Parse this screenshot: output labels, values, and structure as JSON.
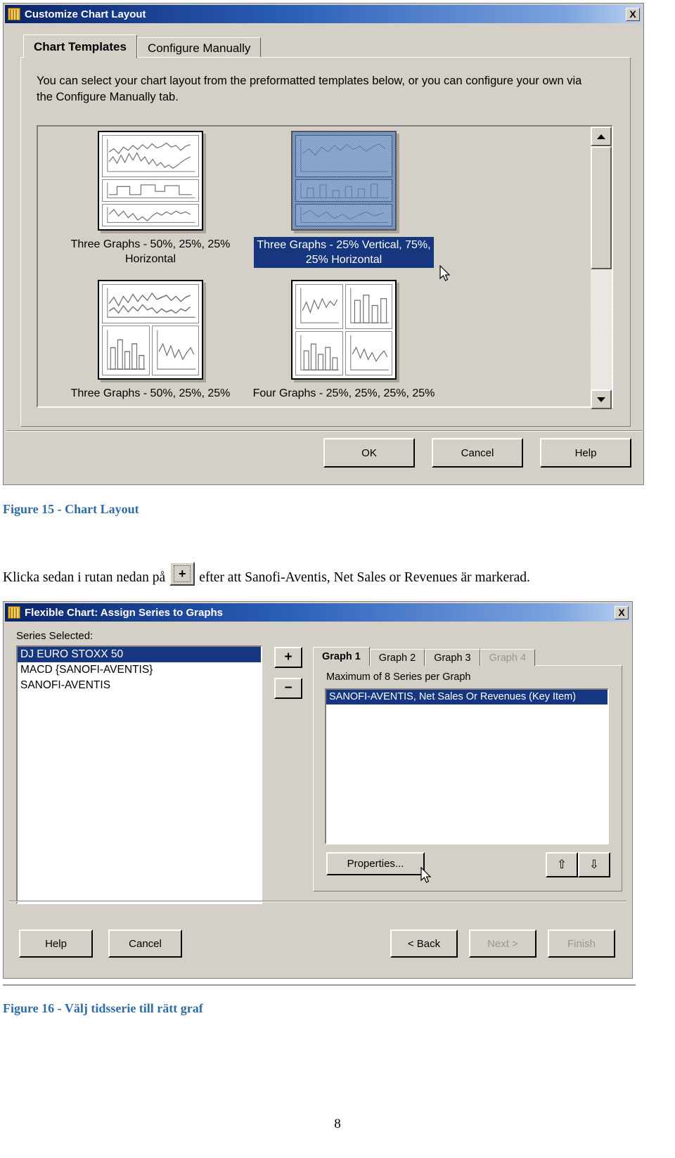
{
  "dialog1": {
    "title": "Customize Chart Layout",
    "close_label": "X",
    "tabs": [
      {
        "label": "Chart Templates",
        "active": true
      },
      {
        "label": "Configure Manually",
        "active": false
      }
    ],
    "intro_text": "You can select your chart layout from the preformatted templates below, or you can configure your own via the Configure Manually tab.",
    "templates": [
      {
        "caption": "Three Graphs - 50%, 25%, 25%\nHorizontal",
        "selected": false
      },
      {
        "caption": "Three Graphs - 25% Vertical, 75%,\n25% Horizontal",
        "selected": true
      },
      {
        "caption": "Three Graphs - 50%, 25%, 25%",
        "selected": false
      },
      {
        "caption": "Four Graphs - 25%, 25%, 25%, 25%",
        "selected": false
      }
    ],
    "scrollbar": {
      "up_label": "▲",
      "down_label": "▼"
    },
    "buttons": [
      {
        "label": "OK",
        "disabled": false
      },
      {
        "label": "Cancel",
        "disabled": false
      },
      {
        "label": "Help",
        "disabled": false
      }
    ]
  },
  "figure15": {
    "caption": "Figure 15 - Chart Layout"
  },
  "body": {
    "before_button": "Klicka sedan i rutan nedan på",
    "button_glyph": "+",
    "after_button": "efter att Sanofi-Aventis, Net Sales or Revenues är markerad."
  },
  "dialog2": {
    "title": "Flexible Chart: Assign Series to Graphs",
    "close_label": "X",
    "series_label": "Series Selected:",
    "series_items": [
      {
        "label": "DJ EURO STOXX 50",
        "selected": true
      },
      {
        "label": "MACD {SANOFI-AVENTIS}",
        "selected": false
      },
      {
        "label": "SANOFI-AVENTIS",
        "selected": false
      }
    ],
    "add_button": "+",
    "remove_button": "−",
    "graph_tabs": [
      {
        "label": "Graph 1",
        "active": true,
        "disabled": false
      },
      {
        "label": "Graph 2",
        "active": false,
        "disabled": false
      },
      {
        "label": "Graph 3",
        "active": false,
        "disabled": false
      },
      {
        "label": "Graph 4",
        "active": false,
        "disabled": true
      }
    ],
    "max_series_text": "Maximum of 8 Series per Graph",
    "graph_items": [
      {
        "label": "SANOFI-AVENTIS, Net Sales Or Revenues (Key Item)",
        "selected": true
      }
    ],
    "properties_button": "Properties...",
    "move_up_button": "⇧",
    "move_down_button": "⇩",
    "left_buttons": [
      {
        "label": "Help",
        "disabled": false
      },
      {
        "label": "Cancel",
        "disabled": false
      }
    ],
    "right_buttons": [
      {
        "label": "< Back",
        "disabled": false
      },
      {
        "label": "Next >",
        "disabled": true
      },
      {
        "label": "Finish",
        "disabled": true
      }
    ]
  },
  "figure16": {
    "caption": "Figure 16 - Välj tidsserie till rätt graf"
  },
  "page": {
    "number": "8"
  },
  "colors": {
    "dialog_face": "#d4d0c8",
    "title_gradient_start": "#0a246a",
    "title_gradient_end": "#b9d0ef",
    "selection_blue": "#16367f",
    "caption_blue": "#2f6ca6"
  }
}
